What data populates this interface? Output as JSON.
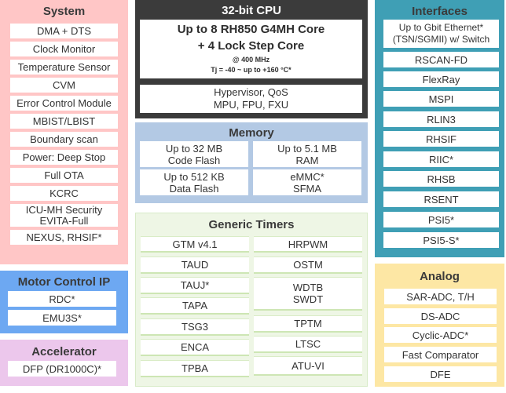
{
  "system": {
    "title": "System",
    "items": [
      "DMA + DTS",
      "Clock Monitor",
      "Temperature Sensor",
      "CVM",
      "Error Control Module",
      "MBIST/LBIST",
      "Boundary scan",
      "Power: Deep Stop",
      "Full OTA",
      "KCRC",
      [
        "ICU-MH Security",
        "EVITA-Full"
      ],
      "NEXUS, RHSIF*"
    ]
  },
  "motor_control": {
    "title": "Motor Control IP",
    "items": [
      "RDC*",
      "EMU3S*"
    ]
  },
  "accelerator": {
    "title": "Accelerator",
    "items": [
      "DFP (DR1000C)*"
    ]
  },
  "cpu": {
    "title": "32-bit CPU",
    "core_line1": "Up to 8 RH850 G4MH Core",
    "core_line2": "+ 4 Lock Step Core",
    "freq": "@ 400 MHz",
    "temp": "Tj = -40 ~  up to +160 °C*",
    "features_line1": "Hypervisor, QoS",
    "features_line2": "MPU, FPU, FXU"
  },
  "memory": {
    "title": "Memory",
    "items": [
      [
        "Up to 32 MB",
        "Code Flash"
      ],
      [
        "Up to 5.1 MB",
        "RAM"
      ],
      [
        "Up to 512 KB",
        "Data Flash"
      ],
      [
        "eMMC*",
        "SFMA"
      ]
    ]
  },
  "timers": {
    "title": "Generic Timers",
    "left": [
      "GTM v4.1",
      "TAUD",
      "TAUJ*",
      "TAPA",
      "TSG3",
      "ENCA",
      "TPBA"
    ],
    "right": [
      "HRPWM",
      "OSTM",
      [
        "WDTB",
        "SWDT"
      ],
      "TPTM",
      "LTSC",
      "ATU-VI"
    ]
  },
  "interfaces": {
    "title": "Interfaces",
    "items": [
      [
        "Up to Gbit Ethernet*",
        "(TSN/SGMII) w/ Switch"
      ],
      "RSCAN-FD",
      "FlexRay",
      "MSPI",
      "RLIN3",
      "RHSIF",
      "RIIC*",
      "RHSB",
      "RSENT",
      "PSI5*",
      "PSI5-S*"
    ]
  },
  "analog": {
    "title": "Analog",
    "items": [
      "SAR-ADC, T/H",
      "DS-ADC",
      "Cyclic-ADC*",
      "Fast Comparator",
      "DFE"
    ]
  },
  "colors": {
    "system": "#ffc6c6",
    "motor_control": "#6da8f2",
    "accelerator": "#ecc7ec",
    "cpu": "#3b3b3b",
    "memory": "#b3c9e4",
    "timers": "#eef6e5",
    "interfaces": "#3f9fb5",
    "analog": "#fde7a4"
  }
}
